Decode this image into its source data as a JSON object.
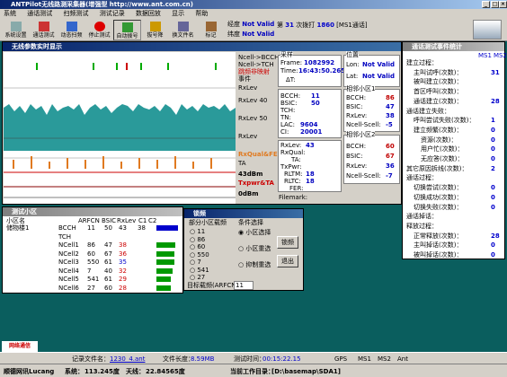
{
  "app_title": "ANTPilot无线路测采集器(增强型 http://www.ant.com.cn)",
  "menu": [
    "系统",
    "通话测试",
    "扫频测试",
    "测试记录",
    "数据回放",
    "显示",
    "帮助"
  ],
  "toolbar": {
    "buttons": [
      "系统设置",
      "通话测试",
      "动态扫频",
      "停止测试",
      "自动拨号",
      "拔号降",
      "换文件名",
      "标记"
    ],
    "longitude_label": "经度",
    "longitude_value": "Not Valid",
    "latitude_label": "纬度",
    "latitude_value": "Not Valid",
    "call_prefix": "第",
    "call_count": "31",
    "call_mid": "次拨打",
    "call_number": "1860",
    "call_suffix": "[MS1通话]"
  },
  "radio_window": {
    "title": "无线参数实时显示",
    "legend": [
      "Ncell->BCCH",
      "Ncell->TCH",
      "跳频非映射",
      "事件"
    ],
    "rxlev_label": "RxLev",
    "rxlev40": "RxLev 40",
    "rxlev50": "RxLev 50",
    "rxlev_end": "RxLev",
    "rxqual_label": "RxQual&FER",
    "ta_label": "TA",
    "dbm43": "43dBm",
    "txpwr_label": "Txpwr&TA",
    "dbm0": "0dBm",
    "collect_title": "采样",
    "frame_label": "Frame:",
    "frame_value": "1082992",
    "time_label": "Time:",
    "time_value": "16:43:50.265",
    "delta_t": "ΔT:",
    "pos_title": "位置",
    "lon_label": "Lon:",
    "lon_value": "Not Valid",
    "lat_label": "Lat:",
    "lat_value": "Not Valid",
    "serv_labels": [
      "BCCH:",
      "BSIC:",
      "TCH:",
      "TN:",
      "LAC:",
      "CI:"
    ],
    "serv_values": [
      "11",
      "50",
      "",
      "",
      "9604",
      "20001"
    ],
    "nc1_title": "相邻小区1",
    "nc1_labels": [
      "BCCH:",
      "BSIC:",
      "RxLev:",
      "Ncell-Scell:"
    ],
    "nc1_values": [
      "86",
      "47",
      "38",
      "-5"
    ],
    "nc2_title": "相邻小区2",
    "nc2_labels": [
      "BCCH:",
      "BSIC:",
      "RxLev:",
      "Ncell-Scell:"
    ],
    "nc2_values": [
      "60",
      "67",
      "36",
      "-7"
    ],
    "meas_labels": [
      "RxLev:",
      "RxQual:",
      "TA:",
      "TxPwr:",
      "RLTM:",
      "RLTC:",
      "FER:"
    ],
    "meas_values": [
      "43",
      "",
      "",
      "",
      "18",
      "18",
      ""
    ],
    "filemark": "Filemark:"
  },
  "cell_window": {
    "title": "测试小区",
    "headers": [
      "小区名",
      "ARFCN",
      "BSIC",
      "RxLev",
      "C1",
      "C2"
    ],
    "serving_name": "储物楼1",
    "rows": [
      {
        "name": "BCCH",
        "arfcn": "11",
        "bsic": "50",
        "rxlev": "43",
        "c1": "38"
      },
      {
        "name": "TCH",
        "arfcn": "",
        "bsic": "",
        "rxlev": "",
        "c1": ""
      },
      {
        "name": "NCell1",
        "arfcn": "86",
        "bsic": "47",
        "rxlev": "38"
      },
      {
        "name": "NCell2",
        "arfcn": "60",
        "bsic": "67",
        "rxlev": "36"
      },
      {
        "name": "NCell3",
        "arfcn": "550",
        "bsic": "61",
        "rxlev": "35"
      },
      {
        "name": "NCell4",
        "arfcn": "7",
        "bsic": "40",
        "rxlev": "32"
      },
      {
        "name": "NCell5",
        "arfcn": "541",
        "bsic": "61",
        "rxlev": "29"
      },
      {
        "name": "NCell6",
        "arfcn": "27",
        "bsic": "60",
        "rxlev": "28"
      }
    ]
  },
  "lock_dialog": {
    "title": "锁频",
    "cell_group": "部分小区载频",
    "freqs": [
      "11",
      "86",
      "60",
      "550",
      "7",
      "541",
      "27"
    ],
    "cond_group": "条件选择",
    "options": [
      "小区选择",
      "小区重选",
      "抑制重选"
    ],
    "lock_btn": "锁频",
    "exit_btn": "退出",
    "target_label": "目标载频(ARFCN)",
    "target_value": "11"
  },
  "event_window": {
    "title": "通话测试事件统计",
    "col_ms1": "MS1",
    "col_ms2": "MS2",
    "rows": [
      {
        "label": "建立过程：",
        "indent": 0,
        "v": ""
      },
      {
        "label": "主叫试呼(次数)：",
        "indent": 1,
        "v": "31"
      },
      {
        "label": "被叫建立(次数)：",
        "indent": 1,
        "v": ""
      },
      {
        "label": "首区呼叫(次数)：",
        "indent": 1,
        "v": ""
      },
      {
        "label": "通话建立(次数)：",
        "indent": 1,
        "v": "28"
      },
      {
        "label": "通话建立失败：",
        "indent": 0,
        "v": ""
      },
      {
        "label": "呼叫尝试失败(次数)：",
        "indent": 1,
        "v": "1"
      },
      {
        "label": "建立频繁(次数)：",
        "indent": 1,
        "v": "0"
      },
      {
        "label": "资源(次数)：",
        "indent": 2,
        "v": "0"
      },
      {
        "label": "用户忙(次数)：",
        "indent": 2,
        "v": "0"
      },
      {
        "label": "无应答(次数)：",
        "indent": 2,
        "v": "0"
      },
      {
        "label": "其它原因拆线(次数)：",
        "indent": 0,
        "v": "2"
      },
      {
        "label": "通话过程：",
        "indent": 0,
        "v": ""
      },
      {
        "label": "切换尝试(次数)：",
        "indent": 1,
        "v": "0"
      },
      {
        "label": "切换成功(次数)：",
        "indent": 1,
        "v": "0"
      },
      {
        "label": "切换失败(次数)：",
        "indent": 1,
        "v": "0"
      },
      {
        "label": "通话掉话：",
        "indent": 0,
        "v": ""
      },
      {
        "label": "释放过程：",
        "indent": 0,
        "v": ""
      },
      {
        "label": "正常释放(次数)：",
        "indent": 1,
        "v": "28"
      },
      {
        "label": "主叫掉话(次数)：",
        "indent": 1,
        "v": "0"
      },
      {
        "label": "被叫掉话(次数)：",
        "indent": 1,
        "v": "0"
      }
    ]
  },
  "statusbar": {
    "file_label": "记录文件名：",
    "file_value": "1230_4.ant",
    "len_label": "文件长度：",
    "len_value": "8.59MB",
    "time_label": "测试时间：",
    "time_value": "00:15:22.15",
    "ind": [
      "GPS",
      "MS1",
      "MS2",
      "Ant"
    ],
    "company": "顺德网讯Lucang",
    "sys_label": "系统：",
    "sys_value": "113.245度",
    "ant_label": "天线：",
    "ant_value": "22.84565度",
    "dir_label": "当前工作目录：",
    "dir_value": "[D:\\basemap\\SDA1]"
  },
  "logo_text": "网络通信"
}
